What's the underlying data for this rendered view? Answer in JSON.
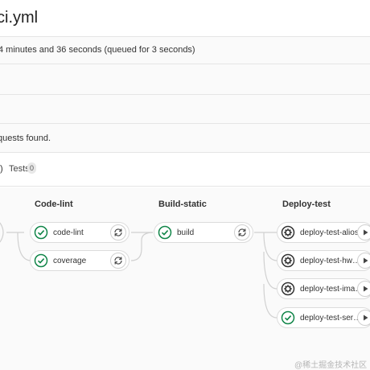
{
  "header": {
    "title": "ci.yml"
  },
  "info": {
    "duration_text": "4 minutes and 36 seconds (queued for 3 seconds)"
  },
  "notice": {
    "text": "quests found."
  },
  "tabs": {
    "separator": ")",
    "tests_label": "Tests",
    "tests_count": "0"
  },
  "pipeline": {
    "stages": [
      {
        "name": "Code-lint",
        "jobs": [
          {
            "name": "code-lint",
            "status": "success",
            "action": "retry"
          },
          {
            "name": "coverage",
            "status": "success",
            "action": "retry"
          }
        ]
      },
      {
        "name": "Build-static",
        "jobs": [
          {
            "name": "build",
            "status": "success",
            "action": "retry"
          }
        ]
      },
      {
        "name": "Deploy-test",
        "jobs": [
          {
            "name": "deploy-test-alioss",
            "status": "manual",
            "action": "play"
          },
          {
            "name": "deploy-test-hw…",
            "status": "manual",
            "action": "play"
          },
          {
            "name": "deploy-test-ima…",
            "status": "manual",
            "action": "play"
          },
          {
            "name": "deploy-test-ser…",
            "status": "success",
            "action": "play"
          }
        ]
      }
    ]
  },
  "watermark": "@稀土掘金技术社区",
  "colors": {
    "success": "#108548",
    "manual": "#333333",
    "border": "#dcdcdc"
  }
}
